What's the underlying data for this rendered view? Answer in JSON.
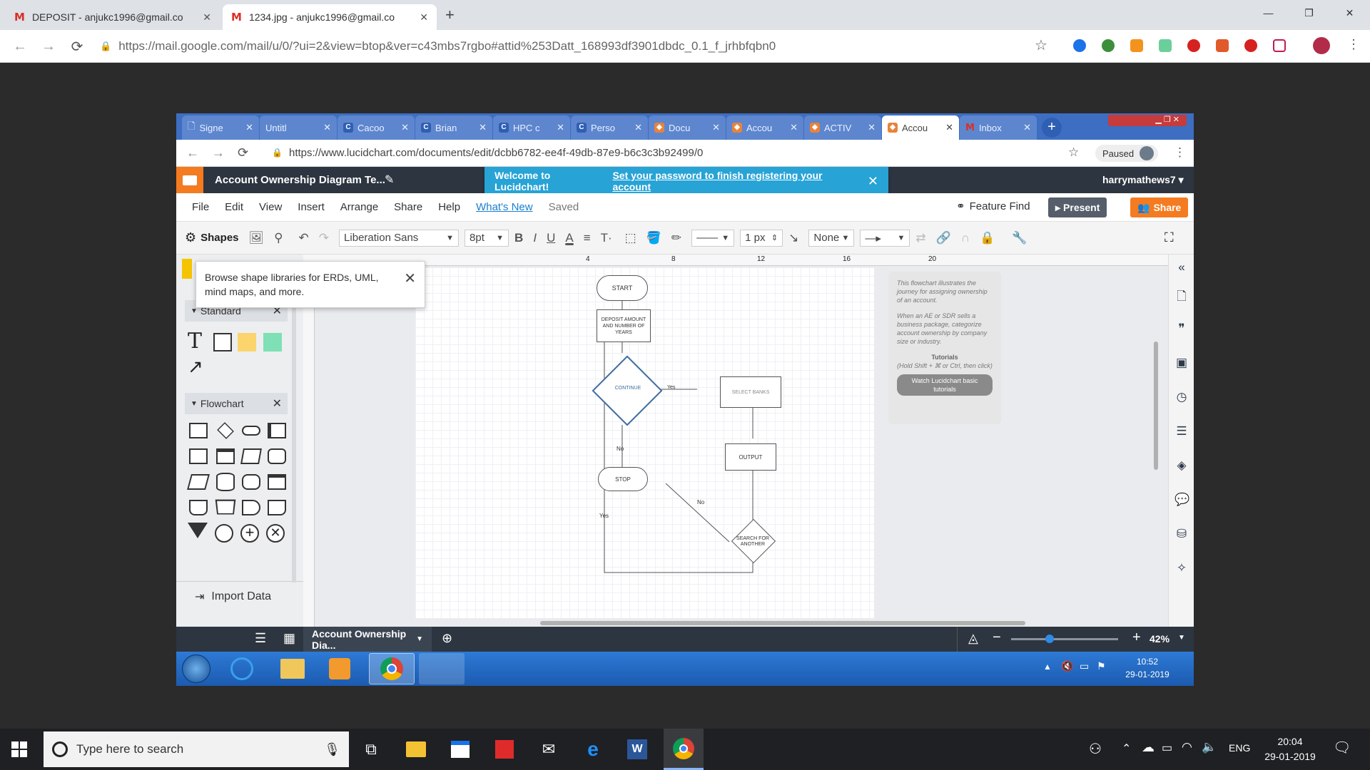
{
  "outer_browser": {
    "tabs": [
      {
        "title": "DEPOSIT - anjukc1996@gmail.co"
      },
      {
        "title": "1234.jpg - anjukc1996@gmail.co"
      }
    ],
    "new_tab": "+",
    "url": "https://mail.google.com/mail/u/0/?ui=2&view=btop&ver=c43mbs7rgbo#attid%253Datt_168993df3901dbdc_0.1_f_jrhbfqbn0",
    "window_controls": [
      "—",
      "❐",
      "✕"
    ]
  },
  "inner_browser": {
    "tabs": [
      "Signe",
      "Untitl",
      "Cacoo",
      "Brian",
      "HPC c",
      "Perso",
      "Docu",
      "Accou",
      "ACTIV",
      "Accou",
      "Inbox"
    ],
    "active_tab_index": 9,
    "url": "https://www.lucidchart.com/documents/edit/dcbb6782-ee4f-49db-87e9-b6c3c3b92499/0",
    "paused_label": "Paused"
  },
  "lucid": {
    "doc_title": "Account Ownership Diagram Te...",
    "banner_text": "Welcome to Lucidchart!",
    "banner_link": "Set your password to finish registering your account",
    "user": "harrymathews7 ▾",
    "menu": [
      "File",
      "Edit",
      "View",
      "Insert",
      "Arrange",
      "Share",
      "Help"
    ],
    "whats_new": "What's New",
    "saved": "Saved",
    "feature_find": "Feature Find",
    "present": "Present",
    "share": "Share",
    "toolbar": {
      "shapes_label": "Shapes",
      "font": "Liberation Sans",
      "font_size": "8pt",
      "line_width": "1 px",
      "arrow_start": "None"
    },
    "tooltip": "Browse shape libraries for ERDs, UML, mind maps, and more.",
    "panels": {
      "standard": "Standard",
      "flowchart": "Flowchart",
      "import": "Import Data"
    },
    "flow": {
      "start": "START",
      "deposit": "DEPOSIT AMOUNT AND NUMBER OF YEARS",
      "continue": "CONTINUE",
      "yes1": "Yes",
      "select": "SELECT BANKS",
      "no1": "No",
      "output": "OUTPUT",
      "stop": "STOP",
      "no2": "No",
      "search": "SEARCH FOR ANOTHER",
      "yes2": "Yes"
    },
    "notes": {
      "p1": "This flowchart illustrates the journey for assigning ownership of an account.",
      "p2": "When an AE or SDR sells a business package, categorize account ownership by company size or industry.",
      "heading": "Tutorials",
      "hint": "(Hold Shift + ⌘ or Ctrl, then click)",
      "button": "Watch Lucidchart basic tutorials"
    },
    "page_tab": "Account Ownership Dia...",
    "zoom": "42%",
    "ruler_marks": [
      "4",
      "8",
      "12",
      "16",
      "20"
    ]
  },
  "win7_taskbar": {
    "time": "10:52",
    "date": "29-01-2019"
  },
  "win10_taskbar": {
    "search_placeholder": "Type here to search",
    "lang": "ENG",
    "time": "20:04",
    "date": "29-01-2019"
  }
}
